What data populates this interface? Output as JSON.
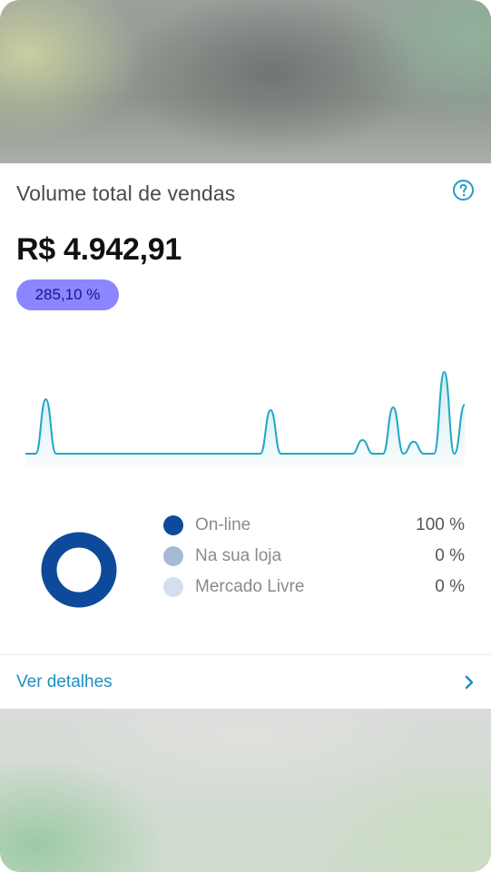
{
  "card": {
    "title": "Volume total de vendas",
    "help_icon": "question-circle-icon",
    "amount": "R$ 4.942,91",
    "growth_badge": "285,10 %",
    "growth_badge_color": "#8b86ff",
    "sparkline": {
      "type": "area",
      "color": "#21a7c4",
      "values": [
        0,
        0,
        1,
        0,
        0,
        0,
        0,
        0,
        0,
        0,
        0,
        0,
        0,
        0,
        0,
        0,
        0,
        0,
        0,
        0,
        0,
        0,
        0,
        0,
        0.8,
        0,
        0,
        0,
        0,
        0,
        0,
        0,
        0,
        0.25,
        0,
        0,
        0.85,
        0,
        0.22,
        0,
        0,
        1.5,
        0,
        0.9
      ]
    },
    "distribution": {
      "items": [
        {
          "label": "On-line",
          "value": "100 %",
          "color": "#0d4a9b"
        },
        {
          "label": "Na sua loja",
          "value": "0 %",
          "color": "#a7bbd8"
        },
        {
          "label": "Mercado Livre",
          "value": "0 %",
          "color": "#d4deee"
        }
      ],
      "online_share": 1.0
    },
    "details_link": "Ver detalhes",
    "details_icon": "chevron-right-icon",
    "accent_color": "#1f8fc2"
  }
}
